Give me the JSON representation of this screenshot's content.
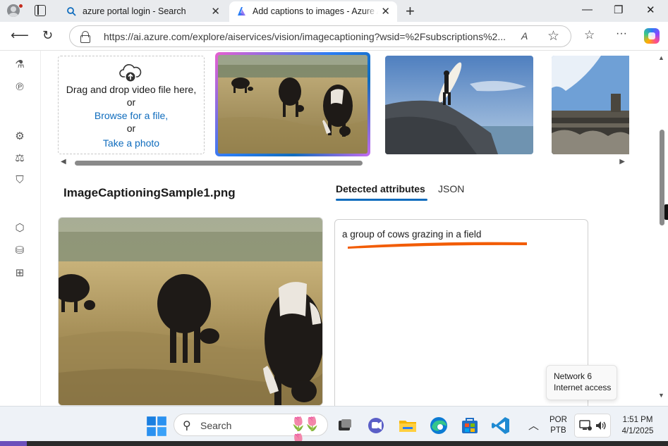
{
  "browser": {
    "tabs": [
      {
        "title": "azure portal login - Search",
        "active": false
      },
      {
        "title": "Add captions to images - Azure AI",
        "active": true
      }
    ],
    "url": "https://ai.azure.com/explore/aiservices/vision/imagecaptioning?wsid=%2Fsubscriptions%2...",
    "window_controls": {
      "minimize": "—",
      "restore": "❐",
      "close": "✕"
    },
    "read_aloud_label": "A",
    "new_tab_label": "+",
    "tab_close_label": "✕"
  },
  "upload": {
    "line1": "Drag and drop video file here,",
    "or1": "or",
    "browse": "Browse for a file,",
    "or2": "or",
    "photo": "Take a photo"
  },
  "samples": {
    "items": [
      "cows",
      "surfer",
      "architecture"
    ],
    "selected": "cows"
  },
  "result": {
    "filename": "ImageCaptioningSample1.png",
    "tabs": [
      "Detected attributes",
      "JSON"
    ],
    "active_tab": "Detected attributes",
    "caption": "a group of cows grazing in a field",
    "highlight_color": "#f25c05"
  },
  "tooltip": {
    "line1": "Network 6",
    "line2": "Internet access"
  },
  "taskbar": {
    "search_placeholder": "Search",
    "lang_line1": "POR",
    "lang_line2": "PTB",
    "time": "1:51 PM",
    "date": "4/1/2025"
  },
  "colors": {
    "accent": "#0f6cbd",
    "underline": "#f25c05"
  }
}
